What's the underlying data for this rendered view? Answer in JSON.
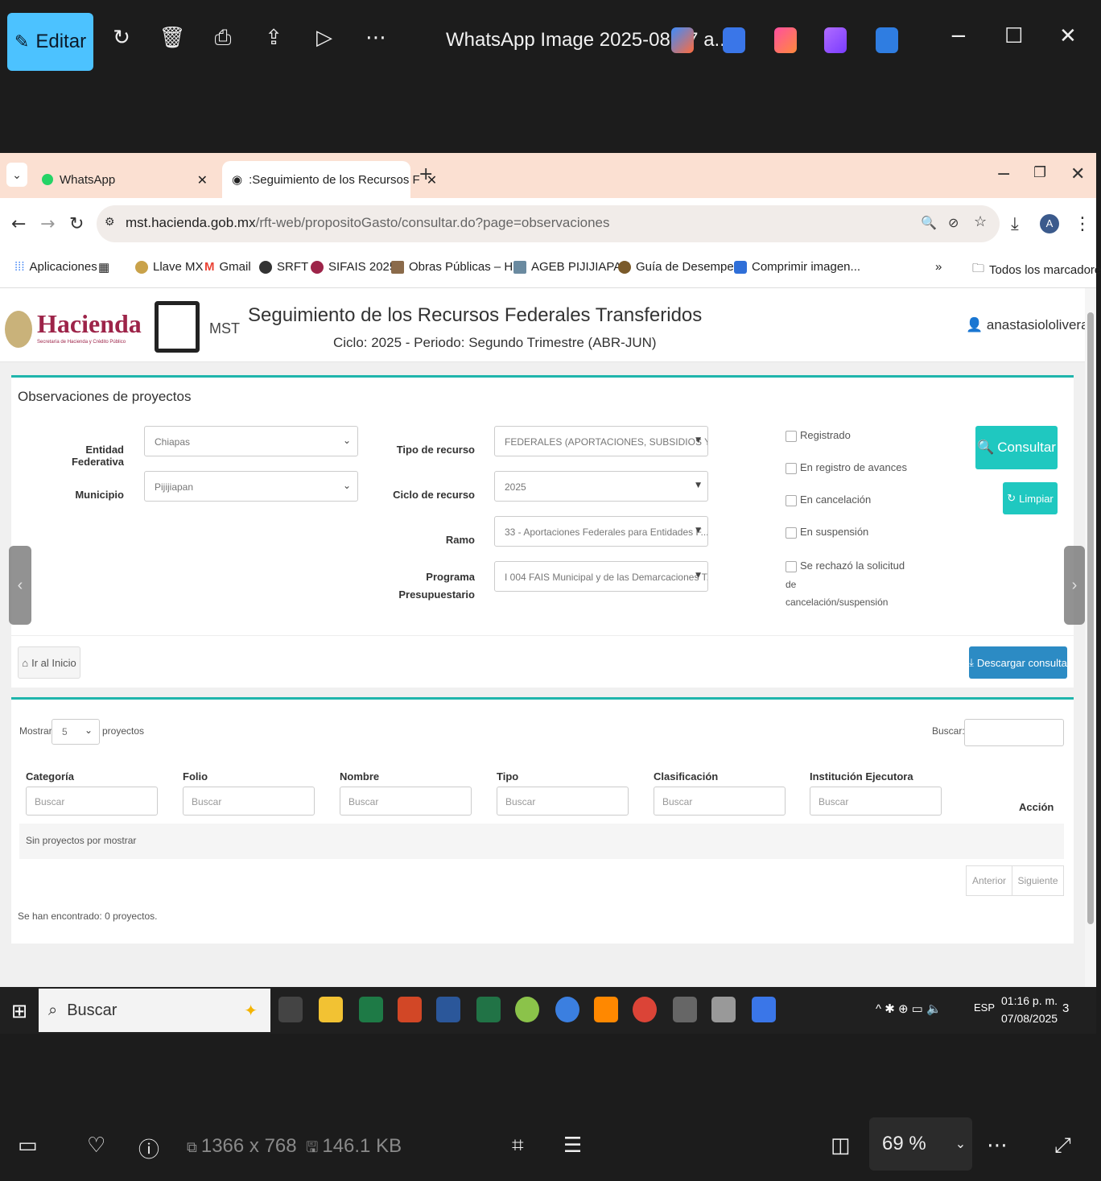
{
  "viewer": {
    "edit_label": "Editar",
    "title": "WhatsApp Image 2025-08-07 a...",
    "dimensions": "1366 x 768",
    "filesize": "146.1 KB",
    "zoom": "69 %"
  },
  "browser": {
    "tabs": [
      {
        "label": "WhatsApp"
      },
      {
        "label": ":Seguimiento de los Recursos F"
      }
    ],
    "url_host": "mst.hacienda.gob.mx",
    "url_path": "/rft-web/propositoGasto/consultar.do?page=observaciones",
    "bookmarks": [
      "Aplicaciones",
      "Llave MX",
      "Gmail",
      "SRFT",
      "SIFAIS 2025",
      "Obras Públicas – H...",
      "AGEB PIJIJIAPAN",
      "Guía de Desempeño",
      "Comprimir imagen...",
      "Todos los marcadores"
    ]
  },
  "header": {
    "brand": "Hacienda",
    "brand_sub": "Secretaría de Hacienda y Crédito Público",
    "mst": "MST",
    "title": "Seguimiento de los Recursos Federales Transferidos",
    "subtitle": "Ciclo: 2025 - Periodo: Segundo Trimestre (ABR-JUN)",
    "user": "anastasiololiverai"
  },
  "filters": {
    "panel_title": "Observaciones de proyectos",
    "entidad_label": "Entidad Federativa",
    "entidad_value": "Chiapas",
    "municipio_label": "Municipio",
    "municipio_value": "Pijijiapan",
    "tipo_label": "Tipo de recurso",
    "tipo_value": "FEDERALES (APORTACIONES, SUBSIDIOS Y C...",
    "ciclo_label": "Ciclo de recurso",
    "ciclo_value": "2025",
    "ramo_label": "Ramo",
    "ramo_value": "33 - Aportaciones Federales para Entidades F...",
    "programa_label_1": "Programa",
    "programa_label_2": "Presupuestario",
    "programa_value": "I 004 FAIS Municipal y de las Demarcaciones T...",
    "checks": [
      "Registrado",
      "En registro de avances",
      "En cancelación",
      "En suspensión",
      "Se rechazó la solicitud"
    ],
    "check_extra_1": "de",
    "check_extra_2": "cancelación/suspensión",
    "consultar": "Consultar",
    "limpiar": "Limpiar",
    "inicio": "Ir al Inicio",
    "descargar": "Descargar consulta"
  },
  "table": {
    "mostrar": "Mostrar",
    "mostrar_value": "5",
    "proyectos": "proyectos",
    "buscar_label": "Buscar:",
    "columns": [
      "Categoría",
      "Folio",
      "Nombre",
      "Tipo",
      "Clasificación",
      "Institución Ejecutora"
    ],
    "column_placeholder": "Buscar",
    "accion": "Acción",
    "empty": "Sin proyectos por mostrar",
    "anterior": "Anterior",
    "siguiente": "Siguiente",
    "footer": "Se han encontrado: 0 proyectos."
  },
  "taskbar": {
    "search": "Buscar",
    "lang": "ESP",
    "time": "01:16 p. m.",
    "date": "07/08/2025",
    "notifications": "3"
  }
}
